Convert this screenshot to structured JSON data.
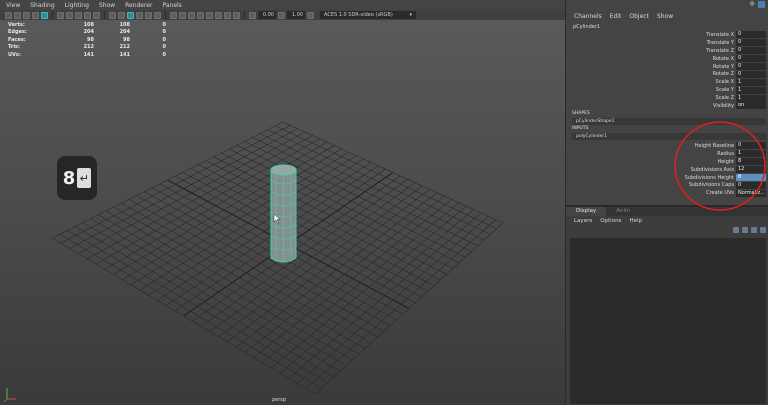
{
  "viewport": {
    "menu": [
      "View",
      "Shading",
      "Lighting",
      "Show",
      "Renderer",
      "Panels"
    ],
    "toolbar": {
      "exposure_value": "0.00",
      "gamma_value": "1.00",
      "colorspace": "ACES 1.0 SDR-video (sRGB)"
    },
    "hud": [
      {
        "label": "Verts:",
        "a": "108",
        "b": "108",
        "c": "0"
      },
      {
        "label": "Edges:",
        "a": "204",
        "b": "204",
        "c": "0"
      },
      {
        "label": "Faces:",
        "a": "98",
        "b": "98",
        "c": "0"
      },
      {
        "label": "Tris:",
        "a": "212",
        "b": "212",
        "c": "0"
      },
      {
        "label": "UVs:",
        "a": "141",
        "b": "141",
        "c": "0"
      }
    ],
    "key_badge": "8",
    "camera_label": "persp"
  },
  "channel_box": {
    "menu": [
      "Channels",
      "Edit",
      "Object",
      "Show"
    ],
    "node_name": "pCylinder1",
    "transform_attrs": [
      {
        "label": "Translate X",
        "value": "0"
      },
      {
        "label": "Translate Y",
        "value": "0"
      },
      {
        "label": "Translate Z",
        "value": "0"
      },
      {
        "label": "Rotate X",
        "value": "0"
      },
      {
        "label": "Rotate Y",
        "value": "0"
      },
      {
        "label": "Rotate Z",
        "value": "0"
      },
      {
        "label": "Scale X",
        "value": "1"
      },
      {
        "label": "Scale Y",
        "value": "1"
      },
      {
        "label": "Scale Z",
        "value": "1"
      },
      {
        "label": "Visibility",
        "value": "on"
      }
    ],
    "shapes_header": "SHAPES",
    "shape_node": "pCylinderShape1",
    "inputs_header": "INPUTS",
    "input_node": "polyCylinder1",
    "input_attrs": [
      {
        "label": "Height Baseline",
        "value": "0"
      },
      {
        "label": "Radius",
        "value": "1"
      },
      {
        "label": "Height",
        "value": "8"
      },
      {
        "label": "Subdivisions Axis",
        "value": "12"
      },
      {
        "label": "Subdivisions Height",
        "value": "8"
      },
      {
        "label": "Subdivisions Caps",
        "value": "0"
      },
      {
        "label": "Create UVs",
        "value": "Normaliz..."
      }
    ]
  },
  "layer_editor": {
    "tabs": [
      "Display",
      "Anim"
    ],
    "menu": [
      "Layers",
      "Options",
      "Help"
    ]
  },
  "colors": {
    "selection_wire": "#3fd3b0",
    "annotation_red": "#e02020",
    "selected_field": "#5d8fbf"
  }
}
